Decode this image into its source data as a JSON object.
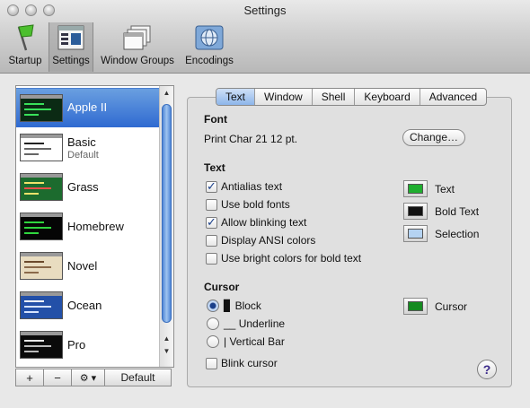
{
  "window": {
    "title": "Settings"
  },
  "toolbar": [
    {
      "label": "Startup",
      "icon": "flag-icon"
    },
    {
      "label": "Settings",
      "icon": "settings-icon"
    },
    {
      "label": "Window Groups",
      "icon": "window-groups-icon"
    },
    {
      "label": "Encodings",
      "icon": "encodings-globe-icon"
    }
  ],
  "profiles": [
    {
      "name": "Apple II",
      "sub": ""
    },
    {
      "name": "Basic",
      "sub": "Default"
    },
    {
      "name": "Grass",
      "sub": ""
    },
    {
      "name": "Homebrew",
      "sub": ""
    },
    {
      "name": "Novel",
      "sub": ""
    },
    {
      "name": "Ocean",
      "sub": ""
    },
    {
      "name": "Pro",
      "sub": ""
    }
  ],
  "list_buttons": {
    "add": "+",
    "remove": "−",
    "gear": "⚙ ▾",
    "default": "Default"
  },
  "tabs": [
    "Text",
    "Window",
    "Shell",
    "Keyboard",
    "Advanced"
  ],
  "font": {
    "heading": "Font",
    "value": "Print Char 21 12 pt.",
    "change_button": "Change…"
  },
  "text_section": {
    "heading": "Text",
    "options": [
      {
        "label": "Antialias text",
        "checked": true
      },
      {
        "label": "Use bold fonts",
        "checked": false
      },
      {
        "label": "Allow blinking text",
        "checked": true
      },
      {
        "label": "Display ANSI colors",
        "checked": false
      },
      {
        "label": "Use bright colors for bold text",
        "checked": false
      }
    ],
    "colors": [
      {
        "label": "Text",
        "color": "#1fae2f"
      },
      {
        "label": "Bold Text",
        "color": "#111111"
      },
      {
        "label": "Selection",
        "color": "#b5d3f2"
      }
    ]
  },
  "cursor_section": {
    "heading": "Cursor",
    "styles": [
      {
        "label": "Block",
        "glyph": "▊",
        "selected": true
      },
      {
        "label": "Underline",
        "glyph": "__",
        "selected": false
      },
      {
        "label": "Vertical Bar",
        "glyph": "|",
        "selected": false
      }
    ],
    "blink_label": "Blink cursor",
    "blink_checked": false,
    "color_label": "Cursor",
    "color": "#158a20"
  },
  "help": "?"
}
